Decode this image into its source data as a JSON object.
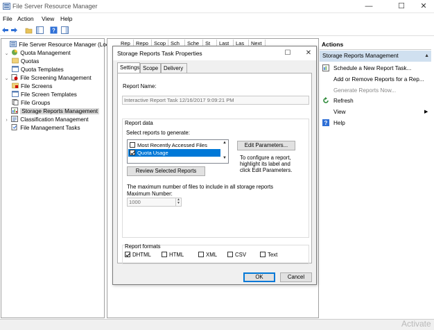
{
  "window": {
    "title": "File Server Resource Manager",
    "minimize": "—",
    "maximize": "☐",
    "close": "✕"
  },
  "menu": {
    "items": [
      "File",
      "Action",
      "View",
      "Help"
    ]
  },
  "tree": {
    "root": "File Server Resource Manager (Local)",
    "quota_management": "Quota Management",
    "quotas": "Quotas",
    "quota_templates": "Quota Templates",
    "file_screening": "File Screening Management",
    "file_screens": "File Screens",
    "file_screen_templates": "File Screen Templates",
    "file_groups": "File Groups",
    "storage_reports": "Storage Reports Management",
    "classification": "Classification Management",
    "file_management_tasks": "File Management Tasks"
  },
  "middle": {
    "columns": [
      "Rep",
      "Repo",
      "Scop",
      "Sch",
      "Sche",
      "St",
      "Last",
      "Las",
      "Next"
    ]
  },
  "actions": {
    "header": "Actions",
    "section": "Storage Reports Management",
    "items": {
      "schedule": "Schedule a New Report Task...",
      "add_remove": "Add or Remove Reports for a Rep...",
      "generate": "Generate Reports Now...",
      "refresh": "Refresh",
      "view": "View",
      "help": "Help"
    }
  },
  "dialog": {
    "title": "Storage Reports Task Properties",
    "tabs": [
      "Settings",
      "Scope",
      "Delivery"
    ],
    "report_name_label": "Report Name:",
    "report_name_value": "Interactive Report Task 12/16/2017 9:09:21 PM",
    "report_data_label": "Report data",
    "select_reports_label": "Select reports to generate:",
    "reports": [
      {
        "name": "Most Recently Accessed Files",
        "checked": false
      },
      {
        "name": "Quota Usage",
        "checked": true
      }
    ],
    "edit_parameters": "Edit Parameters...",
    "configure_hint_1": "To configure a report,",
    "configure_hint_2": "highlight its label and",
    "configure_hint_3": "click Edit Parameters.",
    "review_selected": "Review Selected Reports",
    "max_files_label": "The maximum number of files to include in all storage reports",
    "max_number_label": "Maximum Number:",
    "max_number_value": "1000",
    "report_formats_label": "Report formats",
    "formats": [
      {
        "name": "DHTML",
        "checked": true
      },
      {
        "name": "HTML",
        "checked": false
      },
      {
        "name": "XML",
        "checked": false
      },
      {
        "name": "CSV",
        "checked": false
      },
      {
        "name": "Text",
        "checked": false
      }
    ],
    "ok": "OK",
    "cancel": "Cancel"
  },
  "watermark": "Activate",
  "colors": {
    "selection": "#0078d7",
    "actions_header": "#d0e0f0"
  }
}
